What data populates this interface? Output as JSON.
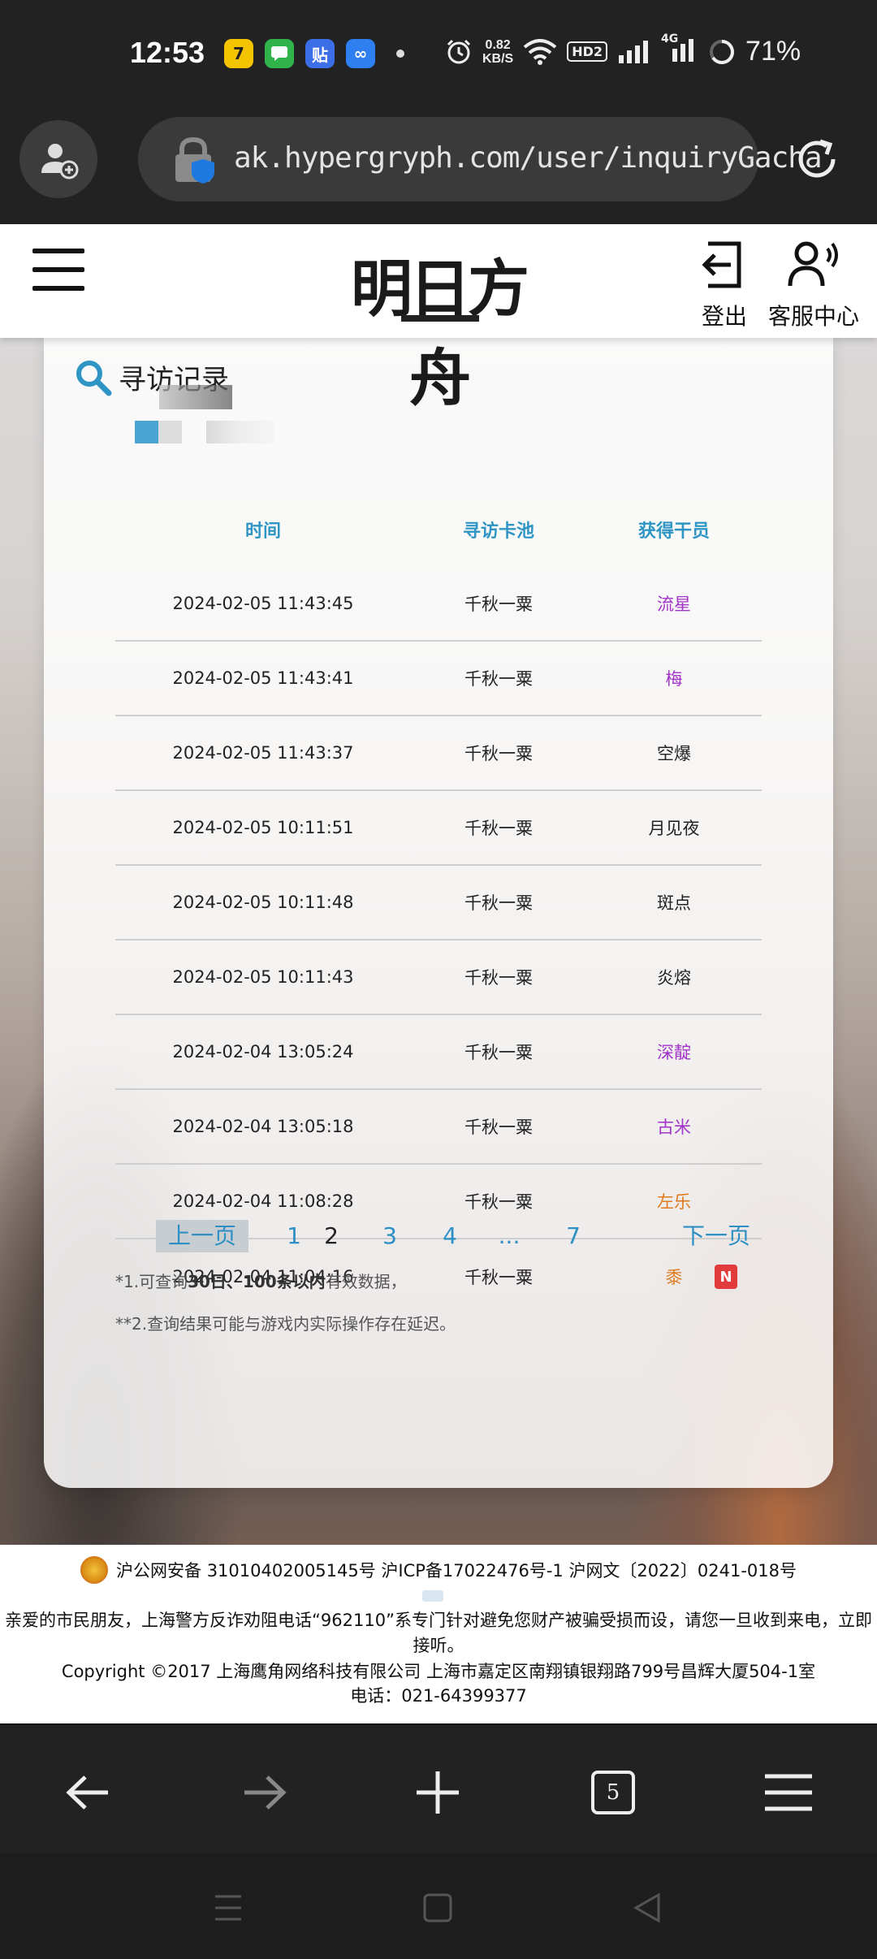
{
  "status_bar": {
    "time": "12:53",
    "apps": [
      {
        "icon": "game-app-icon",
        "label": "7",
        "color": "#f5c400"
      },
      {
        "icon": "messages-app-icon",
        "label": "",
        "color": "#2fb34a"
      },
      {
        "icon": "tieba-app-icon",
        "label": "贴",
        "color": "#3c6ee8"
      },
      {
        "icon": "infinity-app-icon",
        "label": "∞",
        "color": "#2f7ff0"
      }
    ],
    "speed_value": "0.82",
    "speed_unit": "KB/S",
    "hd_label": "HD2",
    "network_label": "4G",
    "battery": "71%"
  },
  "browser": {
    "url": "ak.hypergryph.com/user/inquiryGacha"
  },
  "site_header": {
    "logo_text": "明日方舟",
    "logout_label": "登出",
    "service_label": "客服中心"
  },
  "card": {
    "title": "寻访记录"
  },
  "table": {
    "headers": [
      "时间",
      "寻访卡池",
      "获得干员"
    ],
    "rows": [
      {
        "time": "2024-02-05 11:43:45",
        "pool": "千秋一粟",
        "operator": "流星",
        "rarity": 4,
        "is_new": false
      },
      {
        "time": "2024-02-05 11:43:41",
        "pool": "千秋一粟",
        "operator": "梅",
        "rarity": 4,
        "is_new": false
      },
      {
        "time": "2024-02-05 11:43:37",
        "pool": "千秋一粟",
        "operator": "空爆",
        "rarity": 3,
        "is_new": false
      },
      {
        "time": "2024-02-05 10:11:51",
        "pool": "千秋一粟",
        "operator": "月见夜",
        "rarity": 3,
        "is_new": false
      },
      {
        "time": "2024-02-05 10:11:48",
        "pool": "千秋一粟",
        "operator": "斑点",
        "rarity": 3,
        "is_new": false
      },
      {
        "time": "2024-02-05 10:11:43",
        "pool": "千秋一粟",
        "operator": "炎熔",
        "rarity": 3,
        "is_new": false
      },
      {
        "time": "2024-02-04 13:05:24",
        "pool": "千秋一粟",
        "operator": "深靛",
        "rarity": 4,
        "is_new": false
      },
      {
        "time": "2024-02-04 13:05:18",
        "pool": "千秋一粟",
        "operator": "古米",
        "rarity": 4,
        "is_new": false
      },
      {
        "time": "2024-02-04 11:08:28",
        "pool": "千秋一粟",
        "operator": "左乐",
        "rarity": 5,
        "is_new": false
      },
      {
        "time": "2024-02-04 11:04:16",
        "pool": "千秋一粟",
        "operator": "黍",
        "rarity": 5,
        "is_new": true
      }
    ],
    "new_badge": "N"
  },
  "pager": {
    "prev": "上一页",
    "pages": [
      "1",
      "2",
      "3",
      "4",
      "...",
      "7"
    ],
    "current": "2",
    "next": "下一页"
  },
  "notes": {
    "n1_prefix": "*1.可查询",
    "n1_bold": "30日、100条以内",
    "n1_suffix": "有效数据，",
    "n2": "**2.查询结果可能与游戏内实际操作存在延迟。"
  },
  "footer": {
    "line1": "沪公网安备 31010402005145号  沪ICP备17022476号-1  沪网文〔2022〕0241-018号",
    "line2": "亲爱的市民朋友，上海警方反诈劝阻电话“962110”系专门针对避免您财产被骗受损而设，请您一旦收到来电，立即接听。",
    "line3": "Copyright ©2017 上海鹰角网络科技有限公司  上海市嘉定区南翔镇银翔路799号昌辉大厦504-1室",
    "line4": "电话：021-64399377"
  },
  "bottom_nav": {
    "tab_count": "5"
  },
  "colors": {
    "accent": "#2e95c4",
    "rarity_4": "#a233c9",
    "rarity_5": "#e07a1c",
    "new_badge": "#e23b3b"
  }
}
